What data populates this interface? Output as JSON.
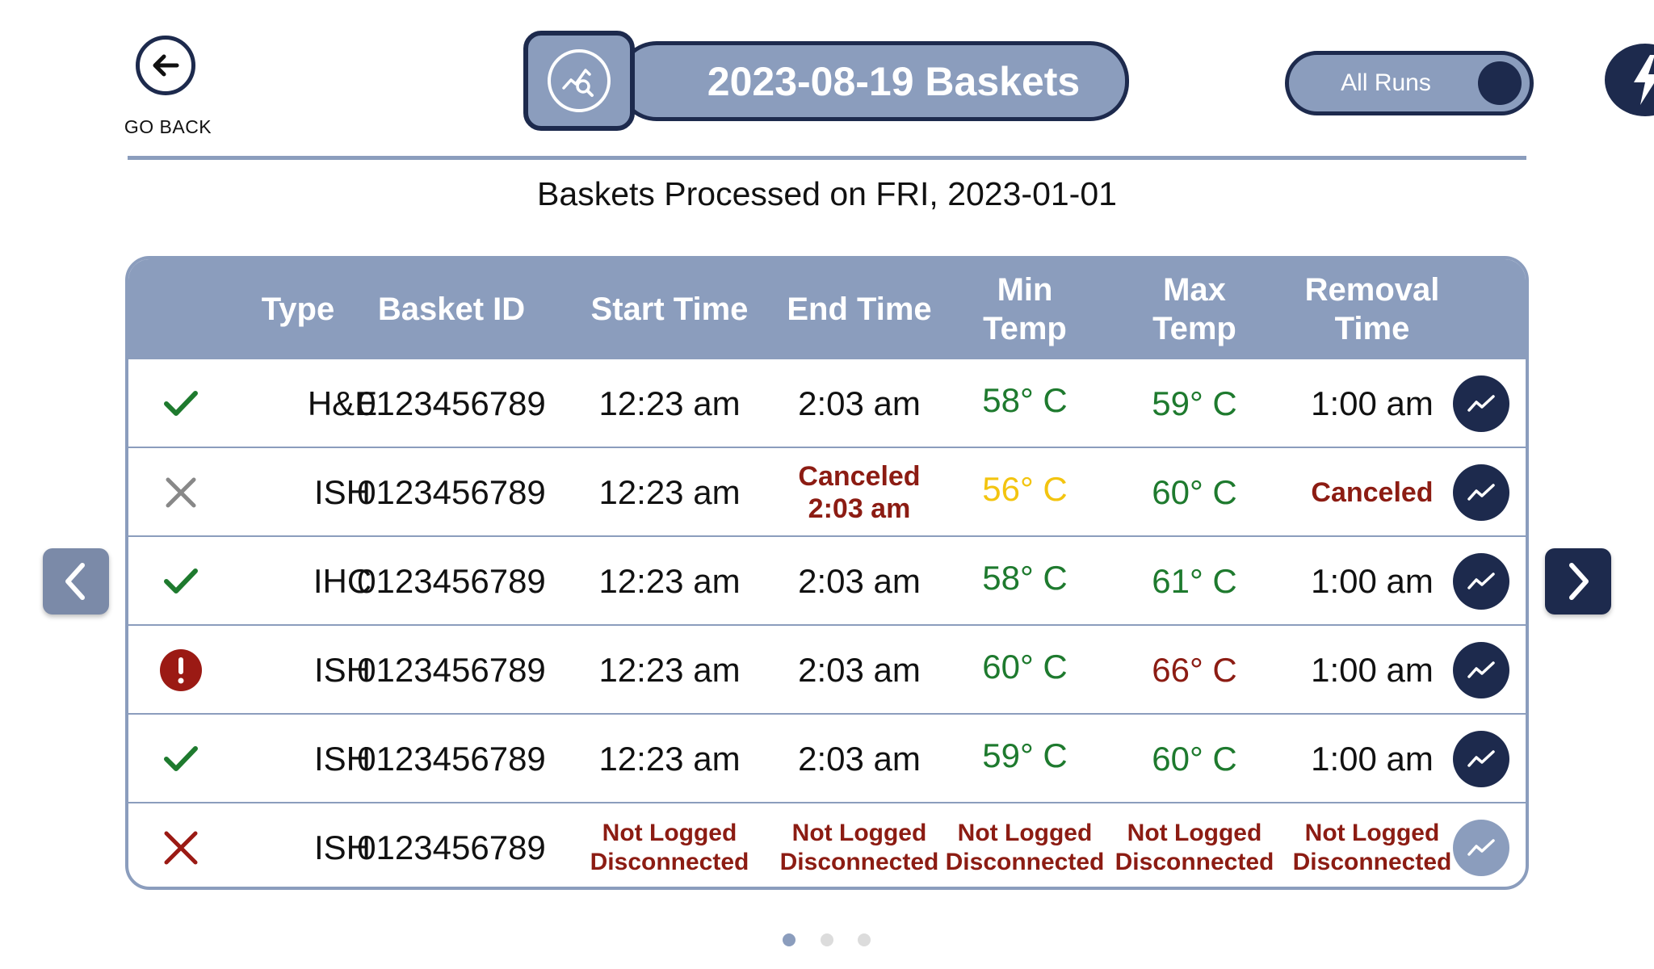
{
  "header": {
    "go_back_label": "GO BACK",
    "title": "2023-08-19 Baskets",
    "toggle_label": "All Runs"
  },
  "subtitle": "Baskets Processed on FRI, 2023-01-01",
  "table": {
    "columns": [
      "Type",
      "Basket ID",
      "Start Time",
      "End Time",
      "Min\nTemp",
      "Max\nTemp",
      "Removal\nTime"
    ],
    "rows": [
      {
        "status": "ok",
        "type": "H&E",
        "basket_id": "0123456789",
        "start": "12:23 am",
        "end": "2:03 am",
        "min_temp": "58° C",
        "max_temp": "59° C",
        "removal": "1:00 am"
      },
      {
        "status": "canceled",
        "type": "ISH",
        "basket_id": "0123456789",
        "start": "12:23 am",
        "end_line1": "Canceled",
        "end_line2": "2:03 am",
        "min_temp": "56° C",
        "max_temp": "60° C",
        "removal": "Canceled"
      },
      {
        "status": "ok",
        "type": "IHC",
        "basket_id": "0123456789",
        "start": "12:23 am",
        "end": "2:03 am",
        "min_temp": "58° C",
        "max_temp": "61° C",
        "removal": "1:00 am"
      },
      {
        "status": "alert",
        "type": "ISH",
        "basket_id": "0123456789",
        "start": "12:23 am",
        "end": "2:03 am",
        "min_temp": "60° C",
        "max_temp": "66° C",
        "removal": "1:00 am"
      },
      {
        "status": "ok",
        "type": "ISH",
        "basket_id": "0123456789",
        "start": "12:23 am",
        "end": "2:03 am",
        "min_temp": "59° C",
        "max_temp": "60° C",
        "removal": "1:00 am"
      },
      {
        "status": "failed",
        "type": "ISH",
        "basket_id": "0123456789",
        "nl1": "Not Logged",
        "nl2": "Disconnected"
      }
    ]
  },
  "colors": {
    "accent": "#8b9dbd",
    "navy": "#1d2a4d",
    "ok_green": "#1e7a2e",
    "error_red": "#8c1c13",
    "warn_yellow": "#f3c40f"
  },
  "icons": [
    "arrow-left-icon",
    "chart-search-icon",
    "lightning-icon",
    "check-icon",
    "x-icon",
    "alert-icon",
    "trend-icon",
    "chevron-left-icon",
    "chevron-right-icon"
  ],
  "pagination": {
    "pages": 3,
    "current": 1
  }
}
